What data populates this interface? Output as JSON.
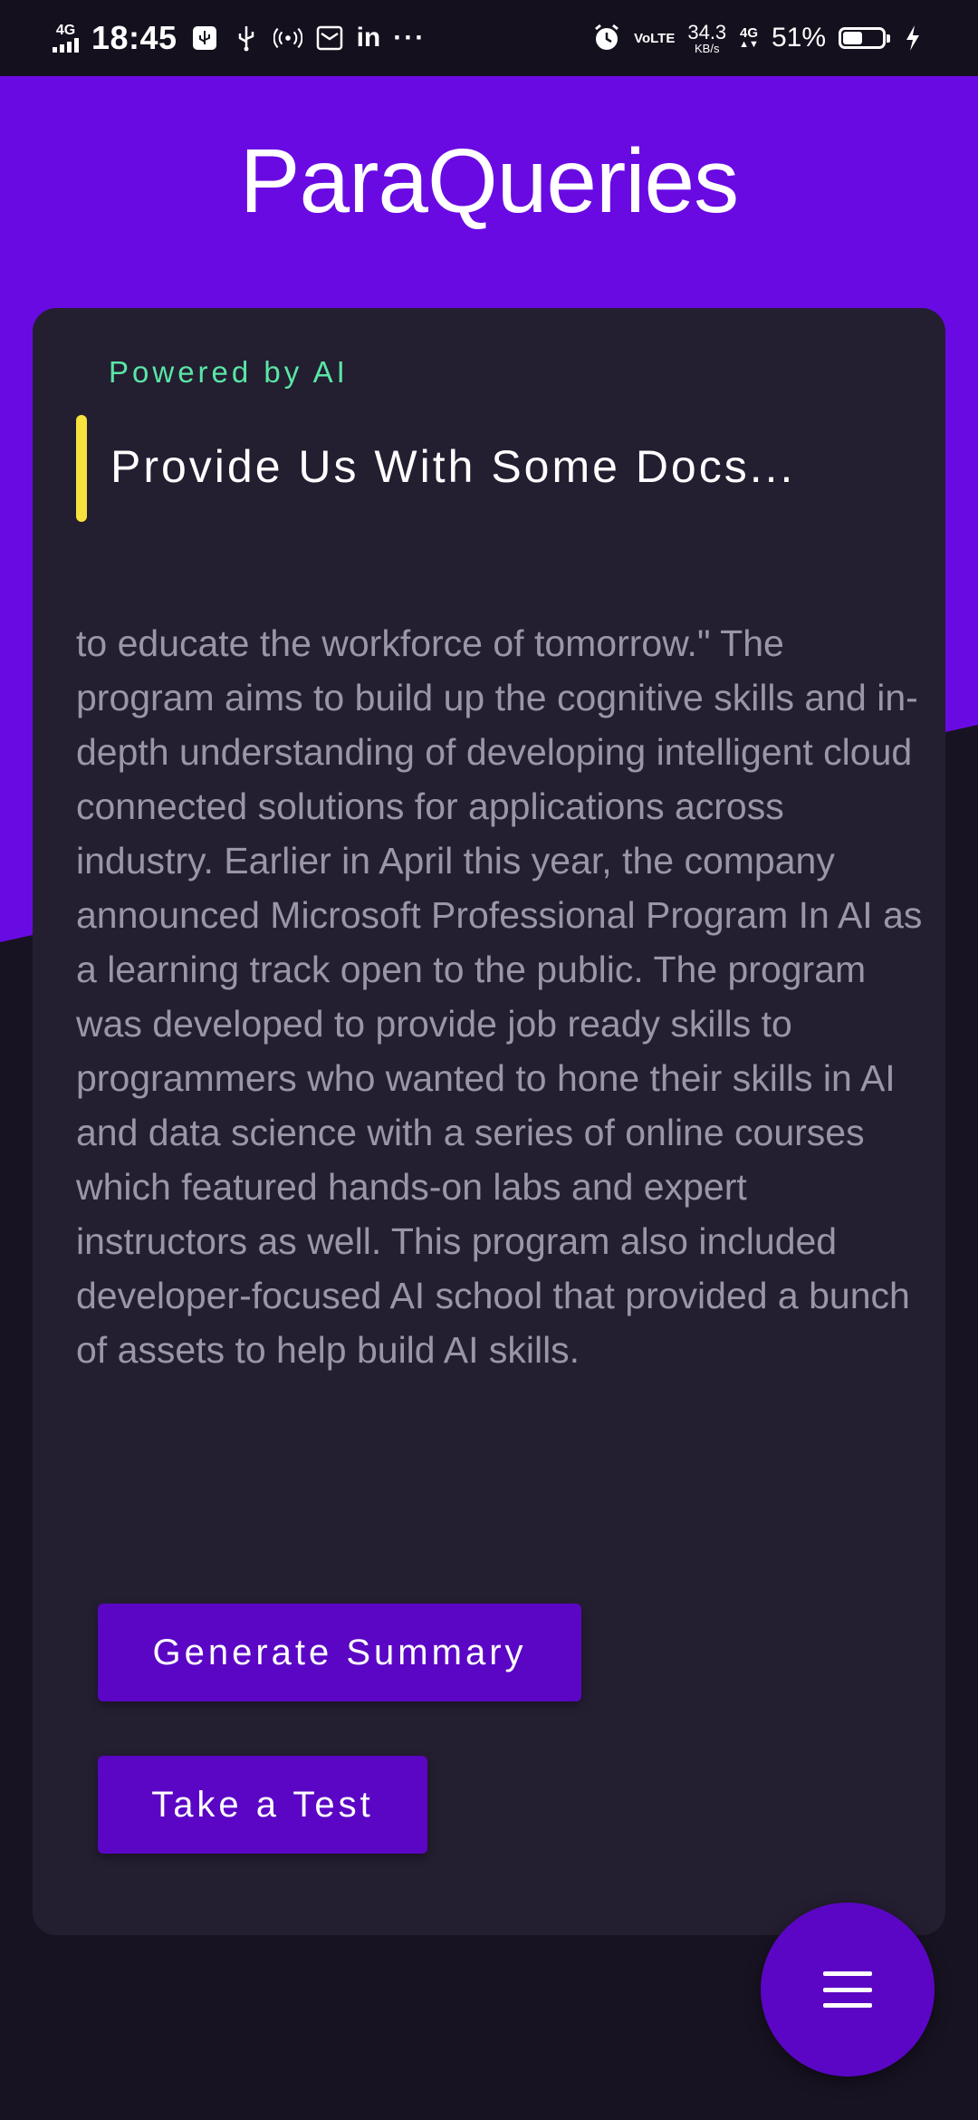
{
  "status_bar": {
    "network_type": "4G",
    "time": "18:45",
    "linkedin_label": "in",
    "more_label": "···",
    "volte_label": "VoLTE",
    "speed_value": "34.3",
    "speed_unit": "KB/s",
    "network_type_right": "4G",
    "battery_percent": "51%",
    "battery_level": 0.51,
    "icons": [
      "signal-icon",
      "usb-icon",
      "hotspot-icon",
      "mail-icon",
      "linkedin-icon",
      "alarm-icon",
      "volte-icon",
      "data-arrows-icon",
      "battery-icon",
      "charging-icon"
    ]
  },
  "header": {
    "title": "ParaQueries",
    "background_color": "#6a0ae3"
  },
  "card": {
    "tagline": "Powered by AI",
    "heading": "Provide Us With Some Docs...",
    "document_text": "to educate the workforce of tomorrow.\" The program aims to build up the cognitive skills and in-depth understanding of developing intelligent cloud connected solutions for applications across industry. Earlier in April this year, the company announced Microsoft Professional Program In AI as a learning track open to the public. The program was developed to provide job ready skills to programmers who wanted to hone their skills in AI and data science with a series of online courses which featured hands-on labs and expert instructors as well. This program also included developer-focused AI school that provided a bunch of assets to help build AI skills.",
    "buttons": {
      "generate_summary": "Generate Summary",
      "take_test": "Take a Test"
    }
  },
  "fab": {
    "icon": "menu-icon"
  },
  "colors": {
    "accent_purple": "#6a0ae3",
    "button_purple": "#5b06c5",
    "tagline_green": "#59e6a6",
    "accent_yellow": "#f7e23e",
    "card_bg": "#241e31",
    "page_bg": "#181322"
  }
}
